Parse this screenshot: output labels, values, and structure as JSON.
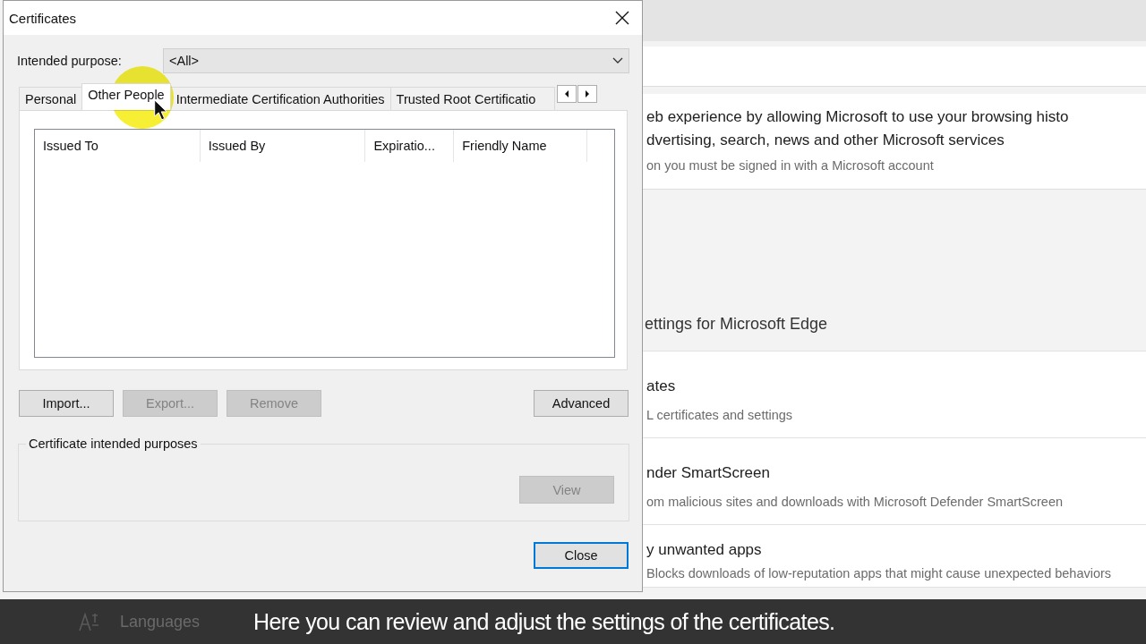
{
  "background": {
    "rows": [
      {
        "kind": "card",
        "title_lines": [
          "eb experience by allowing Microsoft to use your browsing histo",
          "dvertising, search, news and other Microsoft services"
        ],
        "subtitle": "on you must be signed in with a Microsoft account"
      },
      {
        "kind": "section",
        "title_lines": [
          "ettings for Microsoft Edge"
        ]
      },
      {
        "kind": "item",
        "title_lines": [
          "ates"
        ],
        "subtitle": "L certificates and settings"
      },
      {
        "kind": "item",
        "title_lines": [
          "nder SmartScreen"
        ],
        "subtitle": "om malicious sites and downloads with Microsoft Defender SmartScreen"
      },
      {
        "kind": "item",
        "title_lines": [
          "y unwanted apps"
        ],
        "subtitle": "Blocks downloads of low-reputation apps that might cause unexpected behaviors"
      }
    ],
    "sidebar_items": [
      {
        "label": "Languages"
      }
    ]
  },
  "dialog": {
    "title": "Certificates",
    "intended_purpose": {
      "label": "Intended purpose:",
      "value": "<All>"
    },
    "tabs": [
      {
        "label": "Personal",
        "selected": false
      },
      {
        "label": "Other People",
        "selected": true
      },
      {
        "label": "Intermediate Certification Authorities",
        "selected": false
      },
      {
        "label": "Trusted Root Certificatio",
        "selected": false
      }
    ],
    "table": {
      "columns": [
        "Issued To",
        "Issued By",
        "Expiratio...",
        "Friendly Name"
      ]
    },
    "buttons": [
      {
        "label": "Import...",
        "disabled": false
      },
      {
        "label": "Export...",
        "disabled": true
      },
      {
        "label": "Remove",
        "disabled": true
      },
      {
        "label": "Advanced",
        "disabled": false
      }
    ],
    "purposes_group": {
      "label": "Certificate intended purposes",
      "view_button": {
        "label": "View",
        "disabled": true
      }
    },
    "close_button": {
      "label": "Close",
      "focused": true
    }
  },
  "caption": "Here you can review and adjust the settings of the certificates."
}
